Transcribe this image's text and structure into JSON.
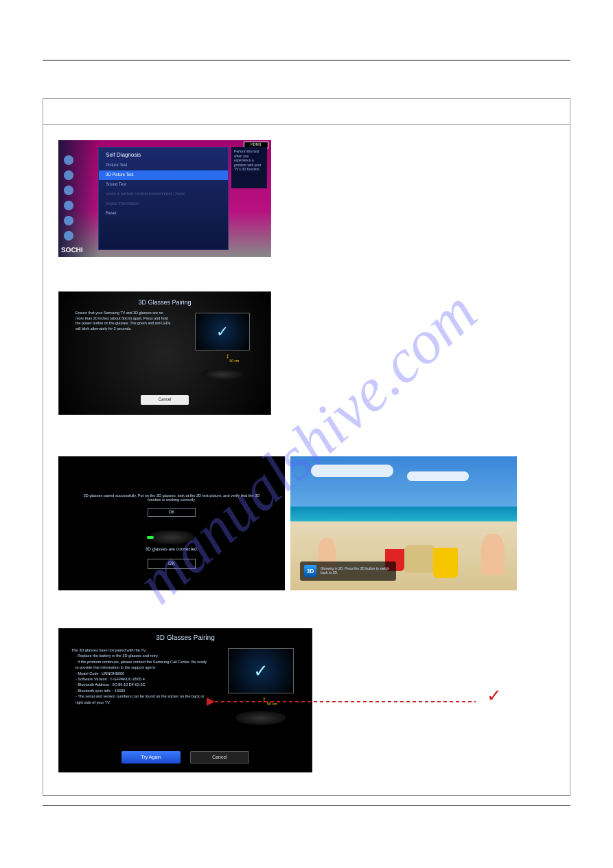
{
  "watermark": "manualshive.com",
  "screens": {
    "selfDiag": {
      "badge": "HDMI1",
      "title": "Self Diagnosis",
      "items": [
        "Picture Test",
        "3D Picture Test",
        "Sound Test",
        "Voice & Motion Control Environment Check",
        "Signal Information",
        "Reset"
      ],
      "sideText": "Perform this test when you experience a problem with your TV's 3D function.",
      "logo": "SOCHI"
    },
    "pairing": {
      "title": "3D Glasses Pairing",
      "instruction": "Ensure that your Samsung TV and 3D glasses are no more than 20 inches (about 50cm) apart. Press and hold the power button on the glasses. The green and red LEDs will blink alternately for 2 seconds.",
      "distance": "50 cm",
      "cancel": "Cancel"
    },
    "connected": {
      "message": "3D glasses paired successfully. Put on the 3D glasses, look at the 3D test picture, and verify that the 3D function is working correctly.",
      "status": "3D glasses are connected.",
      "ok": "OK"
    },
    "beach": {
      "icon": "3D",
      "banner": "Showing in 3D. Press the 3D button to switch back to 2D."
    },
    "pairFail": {
      "title": "3D Glasses Pairing",
      "intro": "The 3D glasses have not paired with the TV.",
      "b1": ". Replace the battery in the 3D glasses and retry.",
      "b2": ". If the problem continues, please contact the Samsung Call Center. Be ready to provide this information to the support agent:",
      "i1": "- Model Code : UNNOH8000",
      "i2": "- Software Version : T-GFPAKUC-0505.4",
      "i3": "- Bluetooth Address : 0C:89:10:DF:62:5C",
      "i4": "- Bluetooth sync info. : 16683",
      "i5": "- The serial and version numbers can be found on the sticker on the back or right side of your TV.",
      "distance": "50 cm",
      "tryAgain": "Try Again",
      "cancel": "Cancel"
    }
  },
  "annotation": {
    "check": "✓"
  }
}
